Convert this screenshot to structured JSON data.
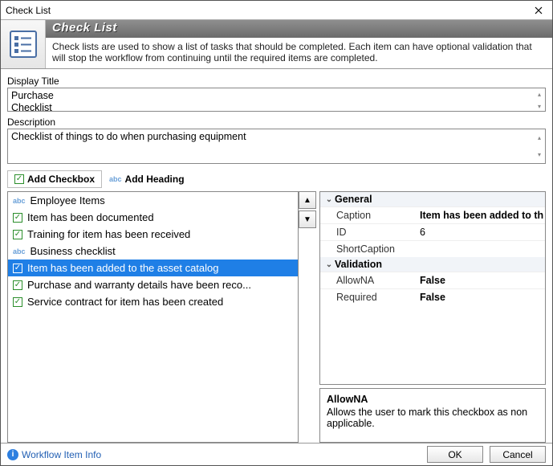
{
  "window": {
    "title": "Check List"
  },
  "banner": {
    "heading": "Check List",
    "description": "Check lists are used to show a list of tasks that should be completed.  Each item can have optional validation that will stop the workflow from continuing until the required items are completed."
  },
  "fields": {
    "display_title_label": "Display Title",
    "display_title_value": "Purchase\nChecklist",
    "description_label": "Description",
    "description_value": "Checklist of things to do when purchasing equipment"
  },
  "toolbar": {
    "add_checkbox": "Add Checkbox",
    "add_heading": "Add Heading"
  },
  "list": {
    "items": [
      {
        "type": "heading",
        "label": "Employee Items"
      },
      {
        "type": "check",
        "label": "Item has been documented"
      },
      {
        "type": "check",
        "label": "Training for item has been received"
      },
      {
        "type": "heading",
        "label": "Business checklist"
      },
      {
        "type": "check",
        "label": "Item has been added to the asset catalog",
        "selected": true
      },
      {
        "type": "check",
        "label": "Purchase and warranty details have been reco..."
      },
      {
        "type": "check",
        "label": "Service contract for item has been created"
      }
    ]
  },
  "properties": {
    "categories": [
      {
        "name": "General",
        "props": [
          {
            "name": "Caption",
            "value": "Item has been added to th",
            "bold": true
          },
          {
            "name": "ID",
            "value": "6"
          },
          {
            "name": "ShortCaption",
            "value": ""
          }
        ]
      },
      {
        "name": "Validation",
        "props": [
          {
            "name": "AllowNA",
            "value": "False",
            "bold": true
          },
          {
            "name": "Required",
            "value": "False",
            "bold": true
          }
        ]
      }
    ]
  },
  "help": {
    "title": "AllowNA",
    "text": "Allows the user to mark this checkbox as non applicable."
  },
  "footer": {
    "info_link": "Workflow Item Info",
    "ok": "OK",
    "cancel": "Cancel"
  }
}
